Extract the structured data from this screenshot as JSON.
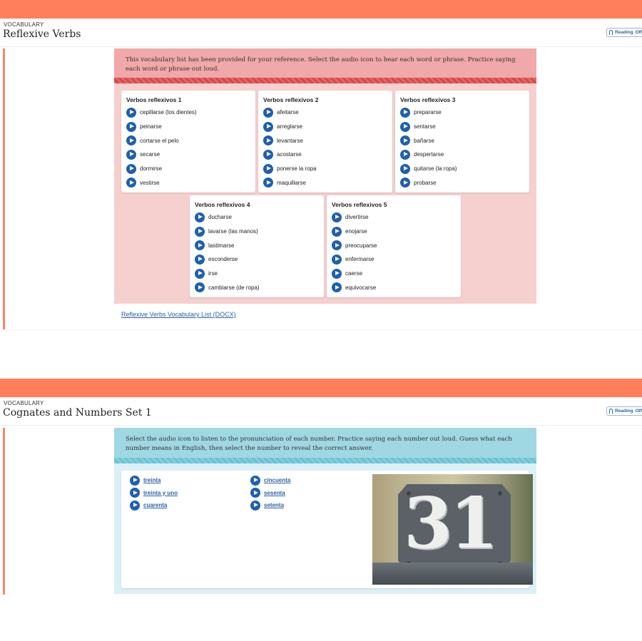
{
  "section1": {
    "kicker": "VOCABULARY",
    "title": "Reflexive Verbs",
    "reading_label": "Reading",
    "reading_state": "Off",
    "instructions": "This vocabulary list has been provided for your reference. Select the audio icon to hear each word or phrase. Practice saying each word or phrase out loud.",
    "cards": [
      {
        "heading": "Verbos reflexivos 1",
        "items": [
          "cepillarse (los dientes)",
          "peinarse",
          "cortarse el pelo",
          "secarse",
          "dormirse",
          "vestirse"
        ]
      },
      {
        "heading": "Verbos reflexivos 2",
        "items": [
          "afeitarse",
          "arreglarse",
          "levantarse",
          "acostarse",
          "ponerse la ropa",
          "maquillarse"
        ]
      },
      {
        "heading": "Verbos reflexivos 3",
        "items": [
          "prepararse",
          "sentarse",
          "bañarse",
          "despertarse",
          "quitarse (la ropa)",
          "probarse"
        ]
      },
      {
        "heading": "Verbos reflexivos 4",
        "items": [
          "ducharse",
          "lavarse (las manos)",
          "lastimarse",
          "esconderse",
          "irse",
          "cambiarse (de ropa)"
        ]
      },
      {
        "heading": "Verbos reflexivos 5",
        "items": [
          "divertirse",
          "enojarse",
          "preocuparse",
          "enfermarse",
          "caerse",
          "equivocarse"
        ]
      }
    ],
    "doc_link": "Reflexive Verbs Vocabulary List (DOCX)"
  },
  "section2": {
    "kicker": "VOCABULARY",
    "title": "Cognates and Numbers Set 1",
    "reading_label": "Reading",
    "reading_state": "Off",
    "instructions": "Select the audio icon to listen to the pronunciation of each number. Practice saying each number out loud. Guess what each number means in English, then select the number to reveal the correct answer.",
    "numbers_col1": [
      "treinta",
      "treinta y uno",
      "cuarenta"
    ],
    "numbers_col2": [
      "cincuenta",
      "sesenta",
      "setenta"
    ],
    "photo_number": "31"
  },
  "colors": {
    "accent_bar": "#ff7f5c",
    "pink_panel": "#f6cfcf",
    "red_stripe": "#d94646",
    "teal_panel": "#dcf0f5",
    "teal_stripe": "#66c2d3",
    "link_blue": "#2a62a8",
    "play_blue": "#1f5fae"
  },
  "icons": {
    "audio": "play-icon",
    "reading": "headphones-icon"
  }
}
